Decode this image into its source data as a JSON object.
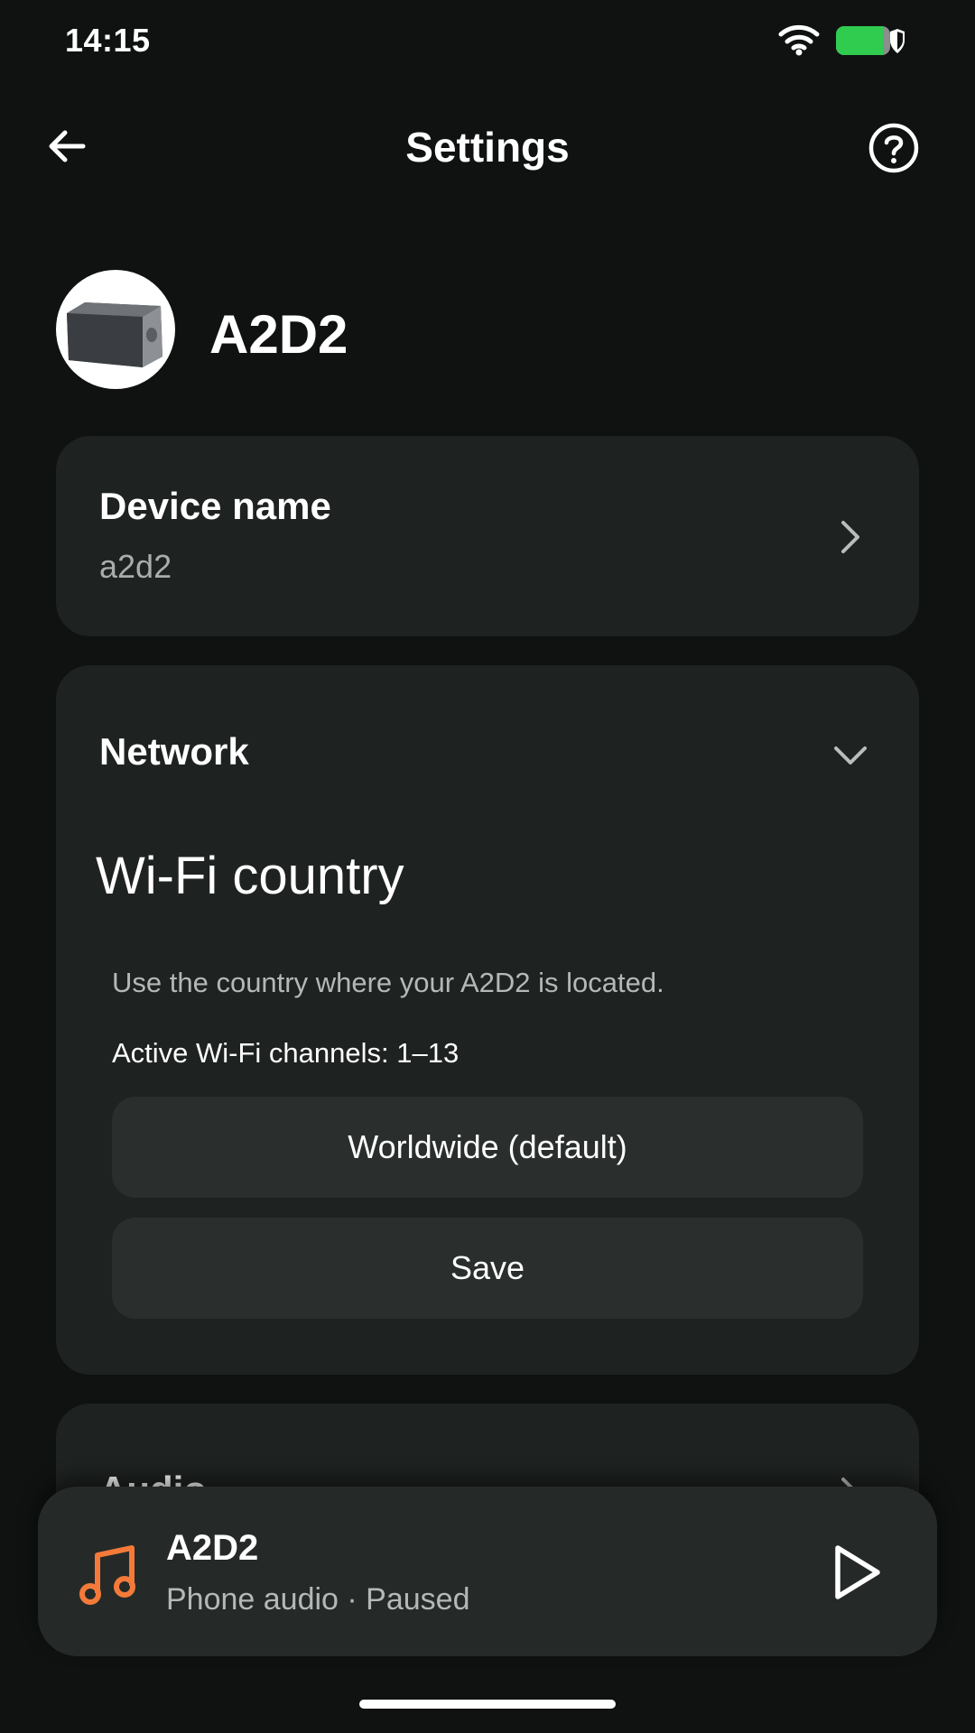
{
  "status_bar": {
    "time": "14:15"
  },
  "header": {
    "title": "Settings"
  },
  "device": {
    "name": "A2D2"
  },
  "device_name_card": {
    "label": "Device name",
    "value": "a2d2"
  },
  "network_card": {
    "label": "Network",
    "wifi_country": {
      "title": "Wi-Fi country",
      "hint": "Use the country where your A2D2 is located.",
      "active_channels": "Active Wi-Fi channels: 1–13",
      "selected_country": "Worldwide (default)",
      "save_label": "Save"
    }
  },
  "audio_card": {
    "label": "Audio"
  },
  "mini_player": {
    "title": "A2D2",
    "subtitle": "Phone audio · Paused"
  },
  "colors": {
    "accent": "#f47a3a",
    "battery": "#2fcc4f",
    "background": "#0f1211",
    "card": "#1e2221"
  }
}
